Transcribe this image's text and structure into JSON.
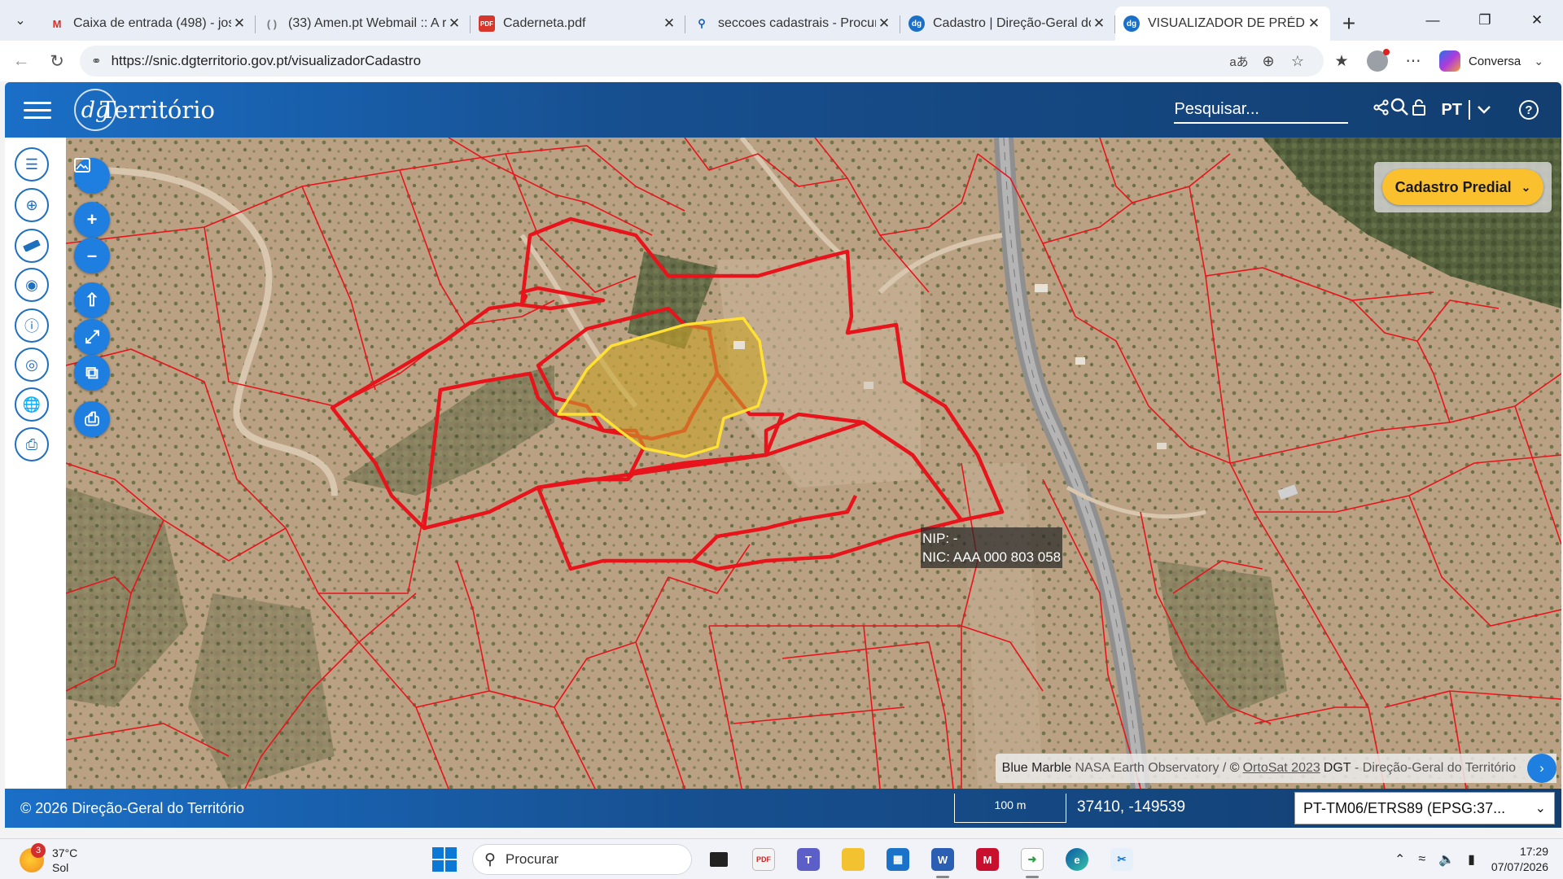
{
  "browser": {
    "tabs": [
      {
        "title": "Caixa de entrada (498) - josea",
        "icon": "gmail-icon",
        "active": false
      },
      {
        "title": "(33) Amen.pt Webmail :: A re",
        "icon": "webmail-icon",
        "active": false
      },
      {
        "title": "Caderneta.pdf",
        "icon": "pdf-icon",
        "active": false
      },
      {
        "title": "seccoes cadastrais - Procurar",
        "icon": "search-icon",
        "active": false
      },
      {
        "title": "Cadastro | Direção-Geral do T",
        "icon": "dgt-icon",
        "active": false
      },
      {
        "title": "VISUALIZADOR DE PRÉDIOS D",
        "icon": "dgt-icon",
        "active": true
      }
    ],
    "url": "https://snic.dgterritorio.gov.pt/visualizadorCadastro",
    "copilot_label": "Conversa"
  },
  "header": {
    "logo_mark": "dg",
    "logo_name": "Território",
    "search_placeholder": "Pesquisar...",
    "language": "PT"
  },
  "map": {
    "layer_label": "Cadastro Predial",
    "tooltip": {
      "nip": "NIP: -",
      "nic": "NIC: AAA 000 803 058"
    },
    "attribution": {
      "blue_marble": "Blue Marble",
      "nasa": "NASA Earth Observatory /",
      "copyright": "©",
      "ortosat": "OrtoSat 2023",
      "dgt": "DGT",
      "dgt_full": "- Direção-Geral do Território"
    },
    "colors": {
      "parcel_line": "#e8141c",
      "selected_fill": "#c9a32a",
      "selected_stroke": "#ffe033",
      "terrain": "#bba183"
    }
  },
  "footer": {
    "copyright": "© 2026 Direção-Geral do Território",
    "scale_label": "100 m",
    "coordinates": "37410, -149539",
    "crs": "PT-TM06/ETRS89 (EPSG:37..."
  },
  "taskbar": {
    "temperature": "37°C",
    "weather": "Sol",
    "weather_badge": "3",
    "search_label": "Procurar",
    "time": "17:29",
    "date": "07/07/2026"
  }
}
